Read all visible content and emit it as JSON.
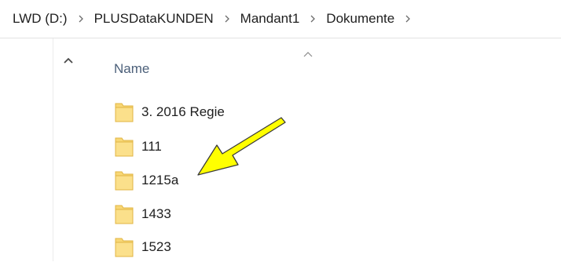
{
  "breadcrumb": {
    "items": [
      {
        "label": "LWD (D:)"
      },
      {
        "label": "PLUSDataKUNDEN"
      },
      {
        "label": "Mandant1"
      },
      {
        "label": "Dokumente"
      }
    ],
    "separator_icon": "chevron-right-icon"
  },
  "navigation": {
    "scroll_up_icon": "chevron-up-icon"
  },
  "columns": {
    "name_label": "Name",
    "sort_icon": "sort-ascending-icon"
  },
  "files": [
    {
      "name": "3.  2016 Regie",
      "icon": "folder-icon"
    },
    {
      "name": "111",
      "icon": "folder-icon"
    },
    {
      "name": "1215a",
      "icon": "folder-icon"
    },
    {
      "name": "1433",
      "icon": "folder-icon"
    },
    {
      "name": "1523",
      "icon": "folder-icon"
    }
  ],
  "colors": {
    "folder_fill": "#f8d775",
    "folder_edge": "#e0b443",
    "column_header_text": "#4c607a",
    "annotation_arrow": "#ffff00"
  }
}
